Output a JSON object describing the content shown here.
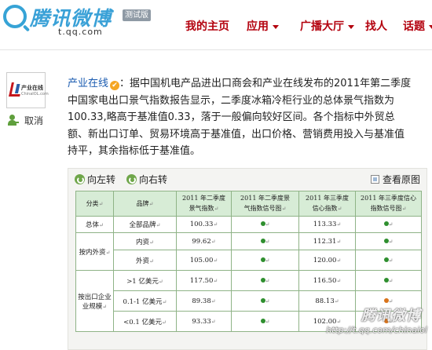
{
  "header": {
    "logo": "腾讯微博",
    "badge": "测试版",
    "domain": "t.qq.com",
    "nav": [
      {
        "label": "我的主页",
        "dropdown": false
      },
      {
        "label": "应用",
        "dropdown": true
      },
      {
        "label": "广播大厅",
        "dropdown": true
      },
      {
        "label": "找人",
        "dropdown": false
      },
      {
        "label": "话题",
        "dropdown": true
      }
    ]
  },
  "sidebar": {
    "avatar_title": "产业在线",
    "avatar_sub": "ChinaIOL.com",
    "unfollow_label": "取消"
  },
  "post": {
    "author": "产业在线",
    "verified_glyph": "✔",
    "lines": [
      "：据中国机电产品进出口商会和产业在线发布的2011年第二季度",
      "中国家电出口景气指数报告显示，二季度冰箱冷柜行业的总体景气指数为",
      "100.33,略高于基准值0.33，落于一般偏向较好区间。各个指标中外贸总",
      "额、新出口订单、贸易环境高于基准值，出口价格、营销费用投入与基准值",
      "持平，其余指标低于基准值。"
    ]
  },
  "media": {
    "rotate_left": "向左转",
    "rotate_right": "向右转",
    "view_original": "查看原图"
  },
  "table": {
    "headers": [
      "分类↵",
      "品牌↵",
      "2011年二季度景气指数↵",
      "2011年二季度景气指数信号图↵",
      "2011年三季度信心指数↵",
      "2011年三季度信心指数信号图↵"
    ],
    "h1": [
      "分类",
      "品牌",
      "2011 年二季度",
      "2011 年二季度景",
      "2011 年三季度",
      "2011 年三季度信心"
    ],
    "h2": [
      "",
      "",
      "景气指数",
      "气指数信号图",
      "信心指数",
      "指数信号图"
    ],
    "rows": [
      {
        "group": "总体",
        "brand": "全部品牌",
        "v1": "100.33",
        "v2": "113.33"
      },
      {
        "group": "按内外资",
        "brand": "内资",
        "v1": "99.62",
        "v2": "112.31"
      },
      {
        "group": "",
        "brand": "外资",
        "v1": "105.00",
        "v2": "120.00"
      },
      {
        "group": "按出口企业规模",
        "brand": ">1 亿美元",
        "v1": "117.50",
        "v2": "116.50"
      },
      {
        "group": "",
        "brand": "0.1-1 亿美元",
        "v1": "89.38",
        "v2": "88.13"
      },
      {
        "group": "",
        "brand": "<0.1 亿美元",
        "v1": "93.33",
        "v2": "102.00"
      }
    ],
    "group_labels": {
      "total": "总体",
      "inout1": "按内外资",
      "size1": "按出口企业",
      "size2": "业规模"
    },
    "return_mark": "↵",
    "signal_colors": {
      "green": "#2f8f2f",
      "orange": "#d9731b"
    },
    "signals_q2": [
      "green",
      "green",
      "green",
      "green",
      "green",
      "green"
    ],
    "signals_q3": [
      "green",
      "green",
      "green",
      "green",
      "orange",
      "orange"
    ]
  },
  "watermark": {
    "logo": "腾讯微博",
    "url": "http://t.qq.com/chinaiol"
  }
}
